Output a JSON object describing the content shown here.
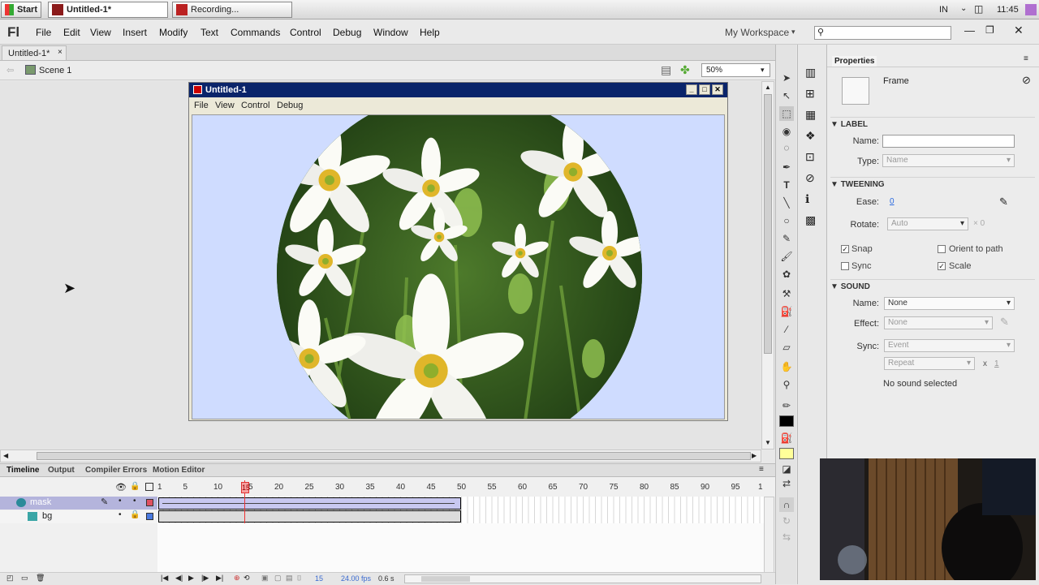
{
  "taskbar": {
    "start_label": "Start",
    "task1_label": "Untitled-1*",
    "task2_label": "Recording...",
    "lang": "IN",
    "clock": "11:45"
  },
  "menubar": {
    "app_logo": "Fl",
    "items": [
      "File",
      "Edit",
      "View",
      "Insert",
      "Modify",
      "Text",
      "Commands",
      "Control",
      "Debug",
      "Window",
      "Help"
    ],
    "workspace_label": "My Workspace",
    "search_placeholder": ""
  },
  "document": {
    "tab_label": "Untitled-1*",
    "scene_label": "Scene 1",
    "zoom_value": "50%"
  },
  "player": {
    "title": "Untitled-1",
    "menu": [
      "File",
      "View",
      "Control",
      "Debug"
    ]
  },
  "properties": {
    "panel_title": "Properties",
    "type_label": "Frame",
    "label_section": "LABEL",
    "name_label": "Name:",
    "name_value": "",
    "type_field_label": "Type:",
    "type_value": "Name",
    "tweening_section": "TWEENING",
    "ease_label": "Ease:",
    "ease_value": "0",
    "rotate_label": "Rotate:",
    "rotate_value": "Auto",
    "rotate_x": "× 0",
    "snap_label": "Snap",
    "orient_label": "Orient to path",
    "sync_label": "Sync",
    "scale_label": "Scale",
    "sound_section": "SOUND",
    "sound_name_label": "Name:",
    "sound_name_value": "None",
    "effect_label": "Effect:",
    "effect_value": "None",
    "sync2_label": "Sync:",
    "sync2_value": "Event",
    "repeat_value": "Repeat",
    "repeat_x": "x",
    "repeat_count": "1",
    "no_sound_text": "No sound selected"
  },
  "timeline": {
    "tabs": [
      "Timeline",
      "Output",
      "Compiler Errors",
      "Motion Editor"
    ],
    "frame_numbers": [
      "1",
      "5",
      "10",
      "15",
      "20",
      "25",
      "30",
      "35",
      "40",
      "45",
      "50",
      "55",
      "60",
      "65",
      "70",
      "75",
      "80",
      "85",
      "90",
      "95",
      "1"
    ],
    "current_frame": "15",
    "layers": [
      {
        "name": "mask"
      },
      {
        "name": "bg"
      }
    ],
    "status_frame": "15",
    "status_fps": "24.00 fps",
    "status_time": "0.6 s"
  }
}
